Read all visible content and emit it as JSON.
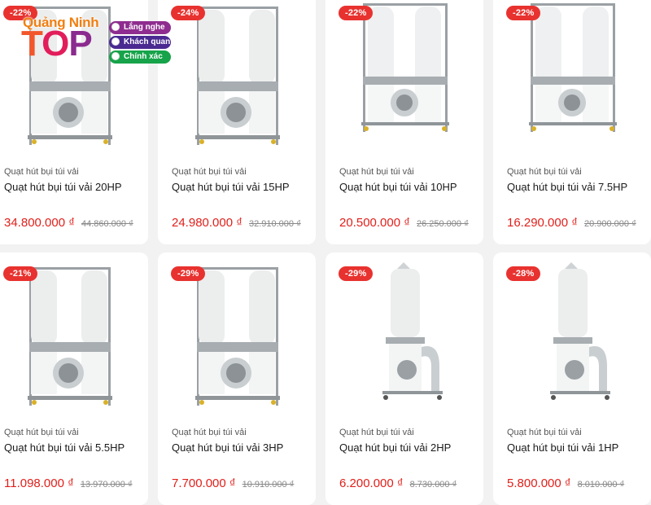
{
  "products": [
    {
      "discount": "-22%",
      "category": "Quạt hút bụi túi vải",
      "name": "Quạt hút bụi túi vải 20HP",
      "price": "34.800.000 ₫",
      "old_price": "44.860.000 ₫",
      "image": "double-bag-collector"
    },
    {
      "discount": "-24%",
      "category": "Quạt hút bụi túi vải",
      "name": "Quạt hút bụi túi vải 15HP",
      "price": "24.980.000 ₫",
      "old_price": "32.910.000 ₫",
      "image": "double-bag-collector"
    },
    {
      "discount": "-22%",
      "category": "Quạt hút bụi túi vải",
      "name": "Quạt hút bụi túi vải 10HP",
      "price": "20.500.000 ₫",
      "old_price": "26.250.000 ₫",
      "image": "double-bag-collector"
    },
    {
      "discount": "-22%",
      "category": "Quạt hút bụi túi vải",
      "name": "Quạt hút bụi túi vải 7.5HP",
      "price": "16.290.000 ₫",
      "old_price": "20.900.000 ₫",
      "image": "double-bag-collector"
    },
    {
      "discount": "-21%",
      "category": "Quạt hút bụi túi vải",
      "name": "Quạt hút bụi túi vải 5.5HP",
      "price": "11.098.000 ₫",
      "old_price": "13.970.000 ₫",
      "image": "double-bag-collector"
    },
    {
      "discount": "-29%",
      "category": "Quạt hút bụi túi vải",
      "name": "Quạt hút bụi túi vải 3HP",
      "price": "7.700.000 ₫",
      "old_price": "10.910.000 ₫",
      "image": "double-bag-collector"
    },
    {
      "discount": "-29%",
      "category": "Quạt hút bụi túi vải",
      "name": "Quạt hút bụi túi vải 2HP",
      "price": "6.200.000 ₫",
      "old_price": "8.730.000 ₫",
      "image": "single-bag-collector"
    },
    {
      "discount": "-28%",
      "category": "Quạt hút bụi túi vải",
      "name": "Quạt hút bụi túi vải 1HP",
      "price": "5.800.000 ₫",
      "old_price": "8.010.000 ₫",
      "image": "single-bag-collector"
    }
  ],
  "watermark": {
    "brand": "Quảng Ninh",
    "top_word": "TOP",
    "tags": [
      "Lắng nghe",
      "Khách quan",
      "Chính xác"
    ],
    "tag_colors": [
      "#8e2d8f",
      "#4a2a91",
      "#17a34a"
    ]
  },
  "colors": {
    "price": "#e0201b",
    "badge": "#e8322f"
  }
}
